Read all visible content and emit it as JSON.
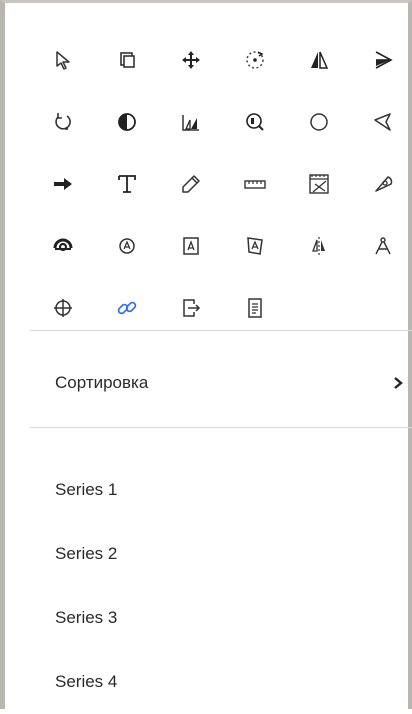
{
  "toolbar": {
    "tools": [
      {
        "icon": "pointer-icon"
      },
      {
        "icon": "copy-icon"
      },
      {
        "icon": "move-icon"
      },
      {
        "icon": "rotate-point-icon"
      },
      {
        "icon": "reflect-line-icon"
      },
      {
        "icon": "ray-icon"
      },
      {
        "icon": "rotate-icon"
      },
      {
        "icon": "contrast-icon"
      },
      {
        "icon": "dilate-icon"
      },
      {
        "icon": "zoom-shape-icon"
      },
      {
        "icon": "circle-icon"
      },
      {
        "icon": "polygon-icon"
      },
      {
        "icon": "arrow-right-icon"
      },
      {
        "icon": "text-icon"
      },
      {
        "icon": "pencil-icon"
      },
      {
        "icon": "ruler-icon"
      },
      {
        "icon": "protractor-ruler-icon"
      },
      {
        "icon": "protractor-icon"
      },
      {
        "icon": "target-icon"
      },
      {
        "icon": "label-point-icon"
      },
      {
        "icon": "label-box-icon"
      },
      {
        "icon": "skew-label-icon"
      },
      {
        "icon": "reflect-label-icon"
      },
      {
        "icon": "compass-icon"
      },
      {
        "icon": "crosshair-icon"
      },
      {
        "icon": "link-icon"
      },
      {
        "icon": "export-icon"
      },
      {
        "icon": "document-icon"
      }
    ],
    "link_color": "#3a6fd8"
  },
  "sort": {
    "label": "Сортировка"
  },
  "series": [
    {
      "label": "Series 1"
    },
    {
      "label": "Series 2"
    },
    {
      "label": "Series 3"
    },
    {
      "label": "Series 4"
    }
  ]
}
